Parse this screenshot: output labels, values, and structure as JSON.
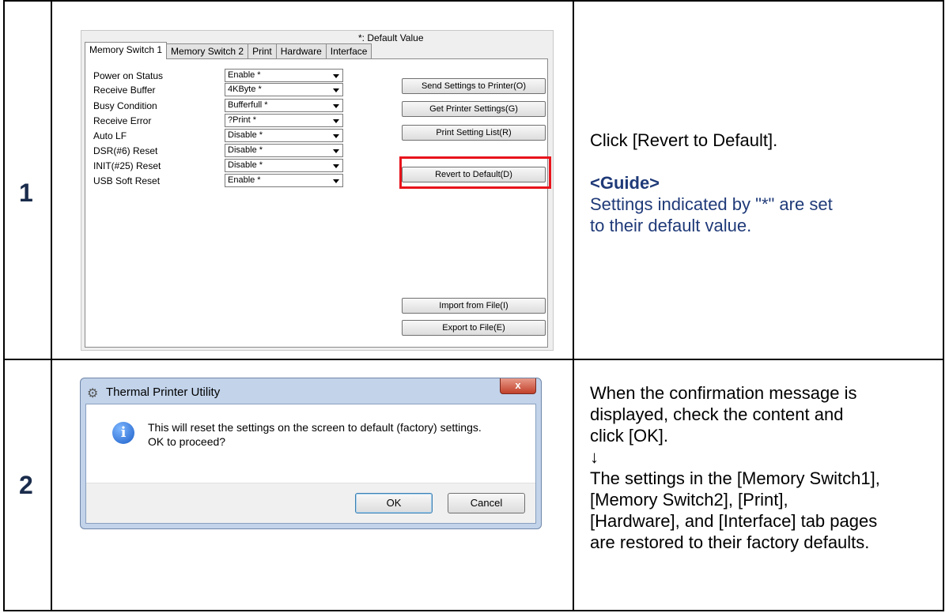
{
  "steps": [
    {
      "number": "1",
      "instruction": "Click [Revert to Default].",
      "guide_title": "<Guide>",
      "guide_text": "Settings indicated by \"*\" are set to their default value."
    },
    {
      "number": "2",
      "lines": [
        "When the confirmation message is",
        "displayed, check the content and",
        "click [OK].",
        "↓",
        "The settings in the [Memory Switch1],",
        "[Memory Switch2], [Print],",
        "[Hardware], and [Interface] tab pages",
        "are restored to their factory defaults."
      ]
    }
  ],
  "settings_window": {
    "default_note": "*: Default Value",
    "tabs": [
      "Memory Switch 1",
      "Memory Switch 2",
      "Print",
      "Hardware",
      "Interface"
    ],
    "active_tab": "Memory Switch 1",
    "settings": [
      {
        "label": "Power on Status",
        "value": "Enable *"
      },
      {
        "label": "Receive Buffer",
        "value": "4KByte *"
      },
      {
        "label": "Busy Condition",
        "value": "Bufferfull *"
      },
      {
        "label": "Receive Error",
        "value": "?Print *"
      },
      {
        "label": "Auto LF",
        "value": "Disable *"
      },
      {
        "label": "DSR(#6) Reset",
        "value": "Disable *"
      },
      {
        "label": "INIT(#25) Reset",
        "value": "Disable *"
      },
      {
        "label": "USB Soft Reset",
        "value": "Enable *"
      }
    ],
    "buttons": {
      "send": "Send Settings to Printer(O)",
      "get": "Get Printer Settings(G)",
      "print_list": "Print Setting List(R)",
      "revert": "Revert to Default(D)",
      "import": "Import from File(I)",
      "export": "Export to File(E)"
    },
    "highlight_color": "#e8141c"
  },
  "dialog": {
    "title": "Thermal Printer Utility",
    "close_glyph": "x",
    "info_glyph": "i",
    "message_line1": "This will reset the settings on the screen to default (factory) settings.",
    "message_line2": "OK to proceed?",
    "ok_label": "OK",
    "cancel_label": "Cancel"
  },
  "colors": {
    "guide": "#1f3a78",
    "step_number": "#1a2c4c"
  }
}
